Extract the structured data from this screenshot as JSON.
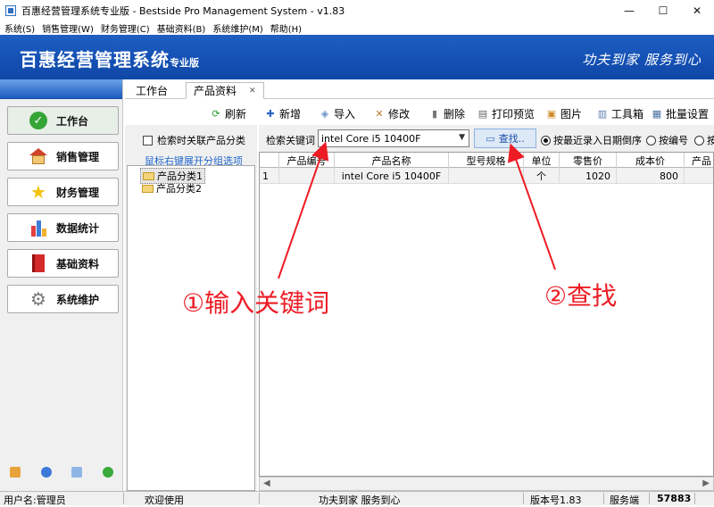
{
  "window": {
    "title": "百惠经营管理系统专业版 - Bestside Pro Management System - v1.83",
    "controls": [
      "—",
      "☐",
      "✕"
    ]
  },
  "menu": [
    "系统(S)",
    "销售管理(W)",
    "财务管理(C)",
    "基础资料(B)",
    "系统维护(M)",
    "帮助(H)"
  ],
  "banner": {
    "title": "百惠经营管理系统",
    "edition": "专业版",
    "slogan": "功夫到家 服务到心"
  },
  "nav": [
    {
      "label": "工作台",
      "icon": "check-icon"
    },
    {
      "label": "销售管理",
      "icon": "house-icon"
    },
    {
      "label": "财务管理",
      "icon": "star-icon"
    },
    {
      "label": "数据统计",
      "icon": "bar-chart-icon"
    },
    {
      "label": "基础资料",
      "icon": "book-icon"
    },
    {
      "label": "系统维护",
      "icon": "gear-icon"
    }
  ],
  "tabs": [
    {
      "label": "工作台"
    },
    {
      "label": "产品资料",
      "close": "✕"
    }
  ],
  "toolbar": {
    "refresh": "刷新",
    "add": "新增",
    "import": "导入",
    "edit": "修改",
    "delete": "删除",
    "print_preview": "打印预览",
    "image": "图片",
    "toolbox": "工具箱",
    "batch_settings": "批量设置"
  },
  "tree": {
    "option_label": "检索时关联产品分类",
    "hint": "鼠标右键展开分组选项",
    "nodes": [
      "产品分类1",
      "产品分类2"
    ]
  },
  "search": {
    "label": "检索关键词",
    "value": "intel Core i5 10400F",
    "find_label": "查找..",
    "sort_options": [
      "按最近录入日期倒序",
      "按编号",
      "按"
    ]
  },
  "grid": {
    "columns": [
      "",
      "产品编号",
      "产品名称",
      "型号规格",
      "单位",
      "零售价",
      "成本价",
      "产品"
    ],
    "rows": [
      [
        "1",
        "",
        "intel Core i5 10400F",
        "",
        "个",
        "1020",
        "800",
        ""
      ]
    ]
  },
  "status": {
    "user": "用户名:管理员",
    "welcome": "欢迎使用",
    "motto": "功夫到家 服务到心",
    "version": "版本号1.83",
    "server_label": "服务端",
    "port": "57883"
  },
  "annotations": {
    "step1": "①输入关键词",
    "step2": "②查找"
  },
  "colors": {
    "banner": "#1551b4",
    "annotation": "#ed1c24",
    "hint": "#2266cc"
  }
}
